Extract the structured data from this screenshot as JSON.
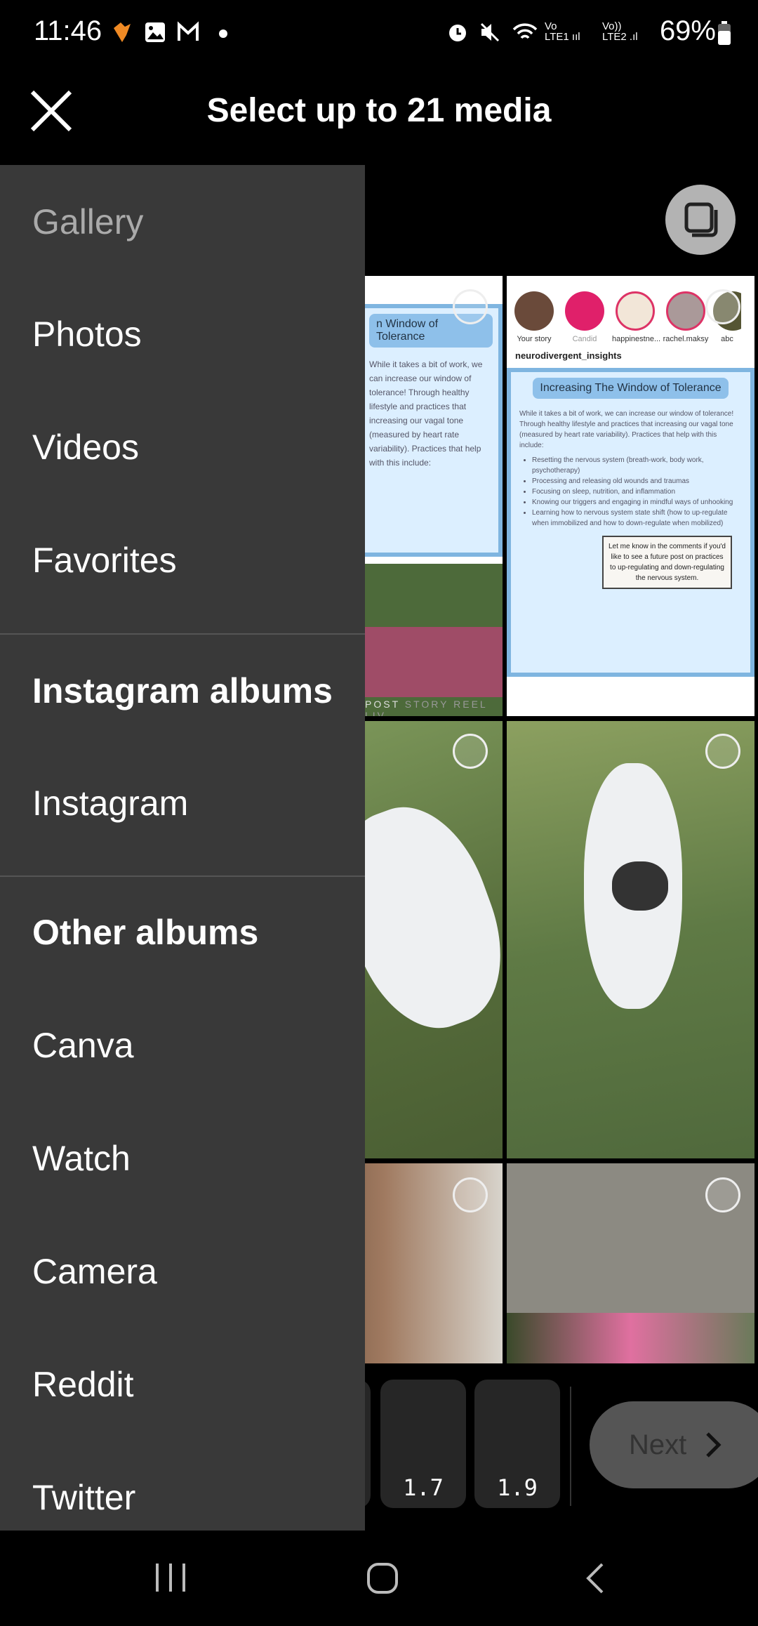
{
  "status_bar": {
    "time": "11:46",
    "battery": "69%",
    "left_icons": [
      "heart-app-icon",
      "gallery-icon",
      "gmail-icon",
      "dot-icon"
    ],
    "right_icons": [
      "alarm-icon",
      "mute-icon",
      "wifi-icon",
      "signal-lte1-icon",
      "signal-lte2-icon",
      "battery-icon"
    ]
  },
  "header": {
    "title": "Select up to 21 media"
  },
  "drawer": {
    "items": [
      {
        "label": "Gallery",
        "type": "muted"
      },
      {
        "label": "Photos",
        "type": "item"
      },
      {
        "label": "Videos",
        "type": "item"
      },
      {
        "label": "Favorites",
        "type": "item"
      },
      {
        "label": "Instagram albums",
        "type": "heading"
      },
      {
        "label": "Instagram",
        "type": "item"
      },
      {
        "label": "Other albums",
        "type": "heading"
      },
      {
        "label": "Canva",
        "type": "item"
      },
      {
        "label": "Watch",
        "type": "item"
      },
      {
        "label": "Camera",
        "type": "item"
      },
      {
        "label": "Reddit",
        "type": "item"
      },
      {
        "label": "Twitter",
        "type": "item"
      }
    ]
  },
  "grid": {
    "screenshot_title": "Increasing The Window of Tolerance",
    "screenshot_title_partial": "n Window of Tolerance",
    "account": "neurodivergent_insights",
    "stories": [
      "Your story",
      "Candid",
      "happinestne...",
      "rachel.maksy",
      "abc"
    ],
    "camera_modes": [
      "POST",
      "STORY",
      "REEL",
      "LIV"
    ],
    "intro": "While it takes a bit of work, we can increase our window of tolerance! Through healthy lifestyle and practices that increasing our vagal tone (measured by heart rate variability). Practices that help with this include:",
    "bullets": [
      "Resetting the nervous system (breath-work, body work, psychotherapy)",
      "Processing and releasing old wounds and traumas",
      "Focusing on sleep, nutrition, and inflammation",
      "Knowing our triggers and engaging in mindful ways of unhooking",
      "Learning how to nervous system state shift (how to up-regulate when immobilized and how to down-regulate when mobilized)"
    ],
    "callout": "Let me know in the comments if you'd like to see a future post on practices to up-regulating and down-regulating the nervous system."
  },
  "bottom": {
    "tiles": [
      "1.7",
      "1.9"
    ],
    "next_label": "Next"
  },
  "colors": {
    "drawer_bg": "#393939",
    "next_bg": "#555555",
    "tile_bg": "#262626"
  }
}
